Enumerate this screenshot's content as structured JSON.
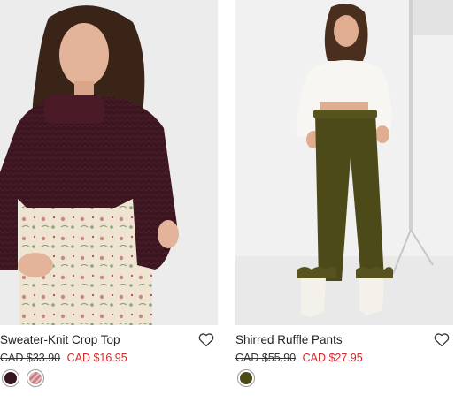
{
  "products": [
    {
      "name": "Sweater-Knit Crop Top",
      "old_price": "CAD $33.90",
      "sale_price": "CAD $16.95",
      "swatches": [
        {
          "icon": "solid-swatch",
          "color": "#3a1420"
        },
        {
          "icon": "striped-swatch",
          "color": "#c97f86"
        }
      ]
    },
    {
      "name": "Shirred Ruffle Pants",
      "old_price": "CAD $55.90",
      "sale_price": "CAD $27.95",
      "swatches": [
        {
          "icon": "solid-swatch",
          "color": "#4d4a1a"
        }
      ]
    }
  ],
  "colors": {
    "sale": "#d9262c",
    "text": "#222222"
  }
}
